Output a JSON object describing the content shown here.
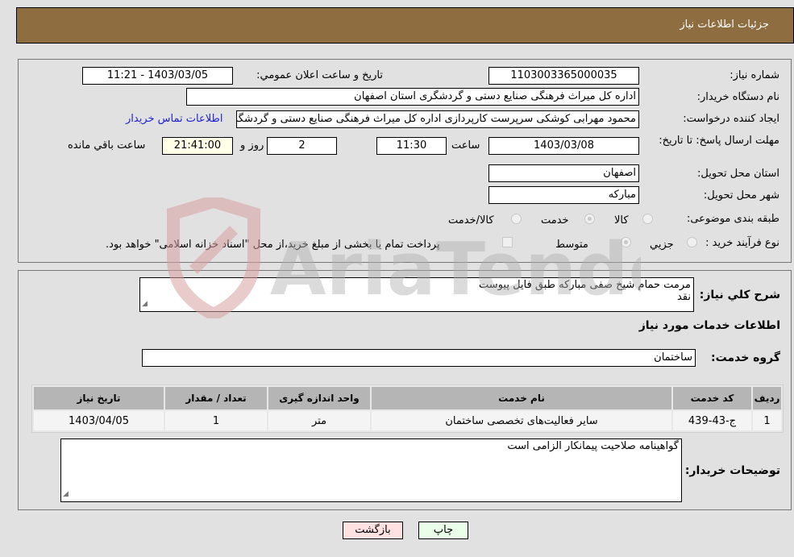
{
  "header": {
    "title": "جزئیات اطلاعات نیاز"
  },
  "details": {
    "need_number": {
      "label": "شماره نیاز:",
      "value": "1103003365000035"
    },
    "announce_datetime": {
      "label": "تاريخ و ساعت اعلان عمومي:",
      "value": "1403/03/05 - 11:21"
    },
    "buyer_org": {
      "label": "نام دستگاه خريدار:",
      "value": "اداره کل میراث فرهنگی  صنایع دستی و گردشگری استان اصفهان"
    },
    "requester": {
      "label": "ايجاد کننده درخواست:",
      "value": "محمود مهرابی کوشکی سرپرست کارپردازی اداره کل میراث فرهنگی  صنایع دستی و گردشگری استان اصفهان",
      "contact_link": "اطلاعات تماس خريدار"
    },
    "deadline": {
      "label": "مهلت ارسال پاسخ: تا تاريخ:",
      "date": "1403/03/08",
      "time_label": "ساعت",
      "time": "11:30",
      "days": "2",
      "days_label": "روز و",
      "remaining": "21:41:00",
      "remaining_label": "ساعت باقي مانده"
    },
    "province": {
      "label": "استان محل تحويل:",
      "value": "اصفهان"
    },
    "city": {
      "label": "شهر محل تحويل:",
      "value": "مبارکه"
    },
    "category": {
      "label": "طبقه بندی موضوعی:",
      "options": [
        {
          "label": "کالا",
          "checked": false
        },
        {
          "label": "خدمت",
          "checked": true
        },
        {
          "label": "کالا/خدمت",
          "checked": false
        }
      ]
    },
    "purchase_type": {
      "label": "نوع فرآیند خرید :",
      "options": [
        {
          "label": "جزيي",
          "checked": false
        },
        {
          "label": "متوسط",
          "checked": true
        }
      ],
      "treasury_checkbox_label": "پرداخت تمام يا بخشی از مبلغ خريد،از محل \"اسناد خزانه اسلامی\" خواهد بود.",
      "treasury_checked": false
    }
  },
  "description": {
    "label": "شرح کلي نياز:",
    "text_line1": "مرمت حمام شیخ صفی مبارکه طبق فایل پیوست",
    "text_line2": "نقد"
  },
  "services": {
    "section_title": "اطلاعات خدمات مورد نياز",
    "group_label": "گروه خدمت:",
    "group_value": "ساختمان",
    "table": {
      "columns": [
        "رديف",
        "کد خدمت",
        "نام خدمت",
        "واحد اندازه گيری",
        "تعداد / مقدار",
        "تاريخ نياز"
      ],
      "rows": [
        [
          "1",
          "ج-43-439",
          "سایر فعالیت‌های تخصصی ساختمان",
          "متر",
          "1",
          "1403/04/05"
        ]
      ]
    }
  },
  "buyer_notes": {
    "label": "توضيحات خريدار:",
    "text": "گواهینامه صلاحیت پیمانکار الزامی است"
  },
  "buttons": {
    "print": "چاپ",
    "back": "بازگشت"
  },
  "watermark": {
    "text": "AriaTender.neT"
  },
  "colors": {
    "header_bg": "#8e6d41",
    "print_bg": "#eaffea",
    "back_bg": "#ffe1e1",
    "link": "#2020d0",
    "remaining_bg": "#ffffe7"
  }
}
